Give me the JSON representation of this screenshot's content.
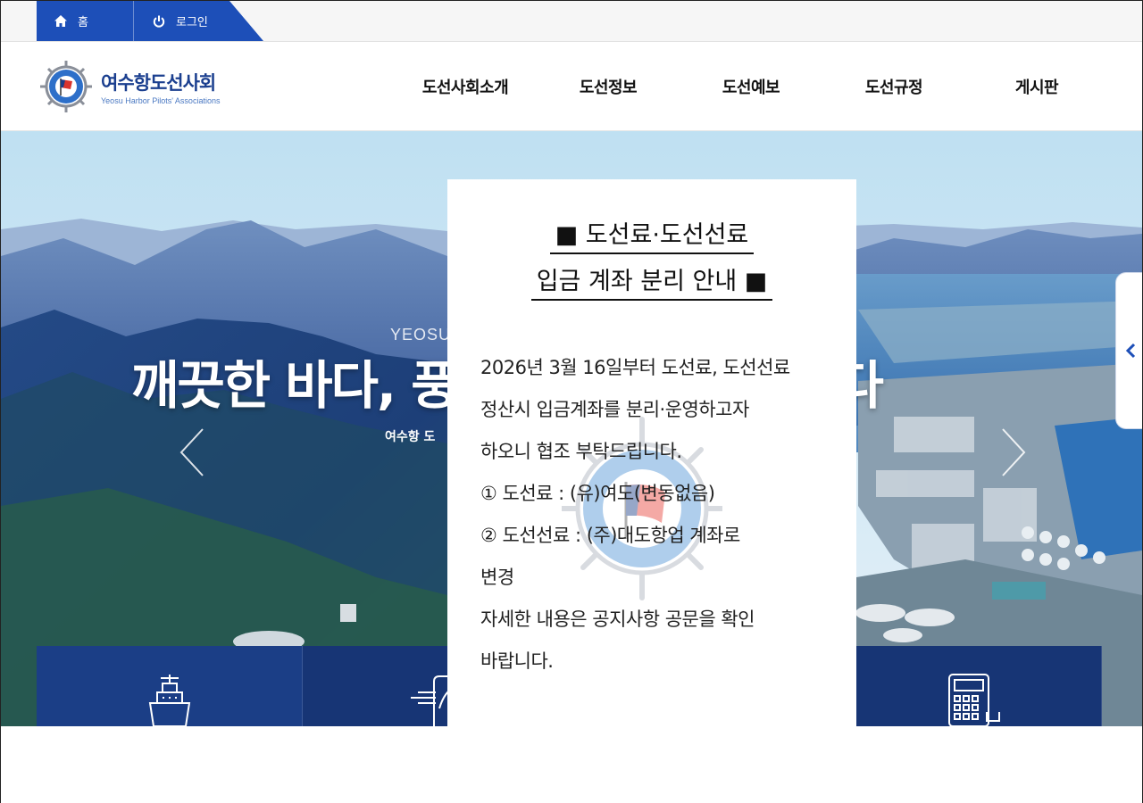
{
  "topbar": {
    "home_label": "홈",
    "login_label": "로그인",
    "home_icon": "home-icon",
    "login_icon": "power-icon"
  },
  "header": {
    "logo_ko": "여수항도선사회",
    "logo_en": "Yeosu Harbor Pilots' Associations",
    "nav": [
      "도선사회소개",
      "도선정보",
      "도선예보",
      "도선규정",
      "게시판"
    ]
  },
  "hero": {
    "small_text": "YEOSU",
    "title": "깨끗한 바다, 풍",
    "title_tail": "한 바다",
    "subtitle": "여수항 도"
  },
  "popup": {
    "title_line1": "■ 도선료·도선선료",
    "title_line2": "입금 계좌 분리 안내 ■",
    "body": [
      "2026년 3월 16일부터 도선료, 도선선료",
      "정산시 입금계좌를 분리·운영하고자",
      "하오니 협조 부탁드립니다.",
      "① 도선료 : (유)여도(변동없음)",
      "② 도선선료 : (주)대도항업 계좌로",
      "변경",
      "자세한 내용은 공지사항 공문을 확인",
      "바랍니다."
    ]
  },
  "colors": {
    "accent": "#1d4fb8",
    "navy": "#1b3e86"
  }
}
